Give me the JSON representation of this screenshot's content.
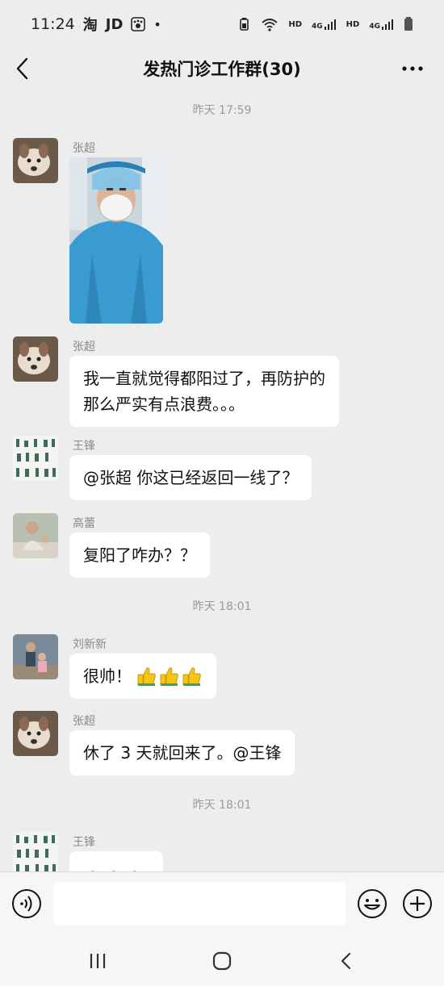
{
  "status_bar": {
    "time": "11:24",
    "app_taobao": "淘",
    "app_jd": "JD",
    "dot": "•",
    "hd1": "HD",
    "net1": "4G",
    "hd2": "HD",
    "net2": "4G"
  },
  "header": {
    "title": "发热门诊工作群(30)"
  },
  "messages": {
    "ts1": "昨天 17:59",
    "m1_sender": "张超",
    "m2_sender": "张超",
    "m2_text_line1": "我一直就觉得都阳过了，再防护的",
    "m2_text_line2": "那么严实有点浪费。。。",
    "m3_sender": "王锋",
    "m3_text": "@张超  你这已经返回一线了？",
    "m4_sender": "高蕾",
    "m4_text": "复阳了咋办？？",
    "ts2": "昨天 18:01",
    "m5_sender": "刘新新",
    "m5_text": "很帅！",
    "m6_sender": "张超",
    "m6_text": "休了 3 天就回来了。@王锋",
    "ts3": "昨天 18:01",
    "m7_sender": "王锋"
  },
  "colors": {
    "background": "#ededed",
    "bubble": "#ffffff",
    "thumb": "#f5c518"
  },
  "icons": {
    "back": "back-arrow-icon",
    "more": "more-dots-icon",
    "voice": "voice-icon",
    "emoji": "emoji-icon",
    "plus": "plus-icon",
    "thumbs": "thumbs-up-icon"
  }
}
